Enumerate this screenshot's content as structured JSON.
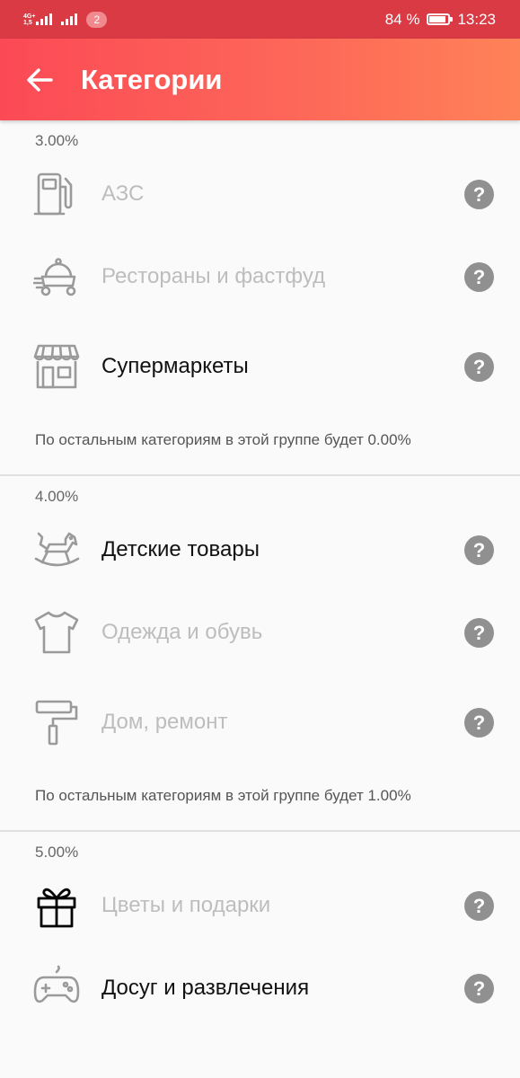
{
  "status_bar": {
    "network_top": "4G+",
    "network_bottom": "1,5",
    "notification_count": "2",
    "battery": "84 %",
    "time": "13:23"
  },
  "app_bar": {
    "title": "Категории",
    "back_icon": "arrow-left-icon"
  },
  "groups": [
    {
      "percent": "3.00%",
      "items": [
        {
          "label": "АЗС",
          "icon": "fuel-pump-icon",
          "selected": false
        },
        {
          "label": "Рестораны и фастфуд",
          "icon": "food-delivery-icon",
          "selected": false
        },
        {
          "label": "Супермаркеты",
          "icon": "store-icon",
          "selected": true
        }
      ],
      "footer": "По остальным категориям в этой группе будет 0.00%"
    },
    {
      "percent": "4.00%",
      "items": [
        {
          "label": "Детские товары",
          "icon": "rocking-horse-icon",
          "selected": true
        },
        {
          "label": "Одежда и обувь",
          "icon": "t-shirt-icon",
          "selected": false
        },
        {
          "label": "Дом, ремонт",
          "icon": "paint-roller-icon",
          "selected": false
        }
      ],
      "footer": "По остальным категориям в этой группе будет 1.00%"
    },
    {
      "percent": "5.00%",
      "items": [
        {
          "label": "Цветы и подарки",
          "icon": "gift-icon",
          "selected": false
        },
        {
          "label": "Досуг и развлечения",
          "icon": "gamepad-icon",
          "selected": true
        }
      ]
    }
  ],
  "help_symbol": "?",
  "colors": {
    "status_bar": "#d93a44",
    "app_bar_start": "#fb4a56",
    "app_bar_end": "#fe8258",
    "selected_text": "#111111",
    "unselected_text": "#bdbdbd",
    "help_bg": "#909090"
  }
}
